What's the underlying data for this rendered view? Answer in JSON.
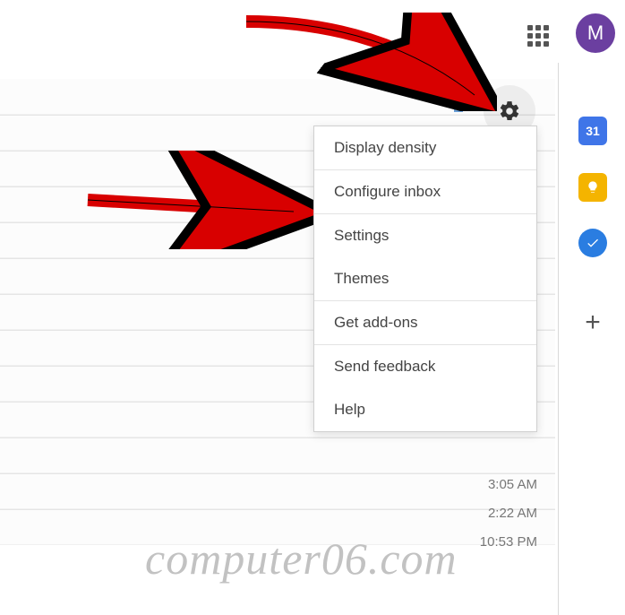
{
  "header": {
    "avatar_letter": "M"
  },
  "menu": {
    "items": {
      "display_density": "Display density",
      "configure_inbox": "Configure inbox",
      "settings": "Settings",
      "themes": "Themes",
      "get_addons": "Get add-ons",
      "send_feedback": "Send feedback",
      "help": "Help"
    }
  },
  "side_panel": {
    "calendar_day": "31"
  },
  "timestamps": {
    "t1": "3:05 AM",
    "t2": "2:22 AM",
    "t3": "10:53 PM"
  },
  "watermark": "computer06.com"
}
